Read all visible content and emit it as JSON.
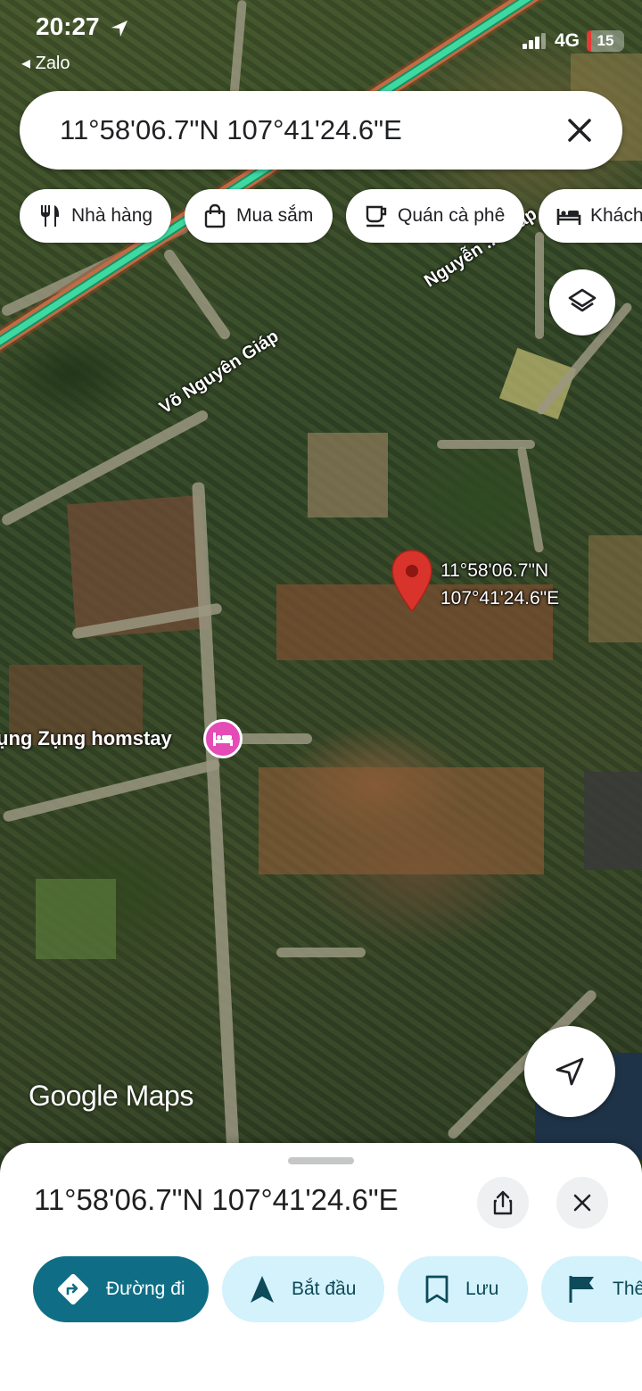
{
  "status_bar": {
    "time": "20:27",
    "back_app": "◂ Zalo",
    "network": "4G",
    "battery": "15"
  },
  "search": {
    "query": "11°58'06.7\"N 107°41'24.6\"E"
  },
  "chips": [
    {
      "label": "Nhà hàng",
      "icon": "restaurant-icon"
    },
    {
      "label": "Mua sắm",
      "icon": "shopping-bag-icon"
    },
    {
      "label": "Quán cà phê",
      "icon": "coffee-icon"
    },
    {
      "label": "Khách",
      "icon": "hotel-bed-icon"
    }
  ],
  "map": {
    "roads": [
      "Võ Nguyên Giáp",
      "Nguyễn ... Giáp"
    ],
    "pin_label_line1": "11°58'06.7\"N",
    "pin_label_line2": "107°41'24.6\"E",
    "poi_label": "ụng Zụng homstay",
    "attribution": "Google Maps",
    "pin_color": "#d9342b",
    "poi_color": "#e54bb7"
  },
  "sheet": {
    "title": "11°58'06.7\"N 107°41'24.6\"E",
    "actions": [
      {
        "label": "Đường đi",
        "icon": "directions-icon",
        "primary": true
      },
      {
        "label": "Bắt đầu",
        "icon": "navigation-arrow-icon"
      },
      {
        "label": "Lưu",
        "icon": "bookmark-icon"
      },
      {
        "label": "Thê",
        "icon": "flag-icon"
      }
    ],
    "accent_color": "#0f6e86"
  }
}
